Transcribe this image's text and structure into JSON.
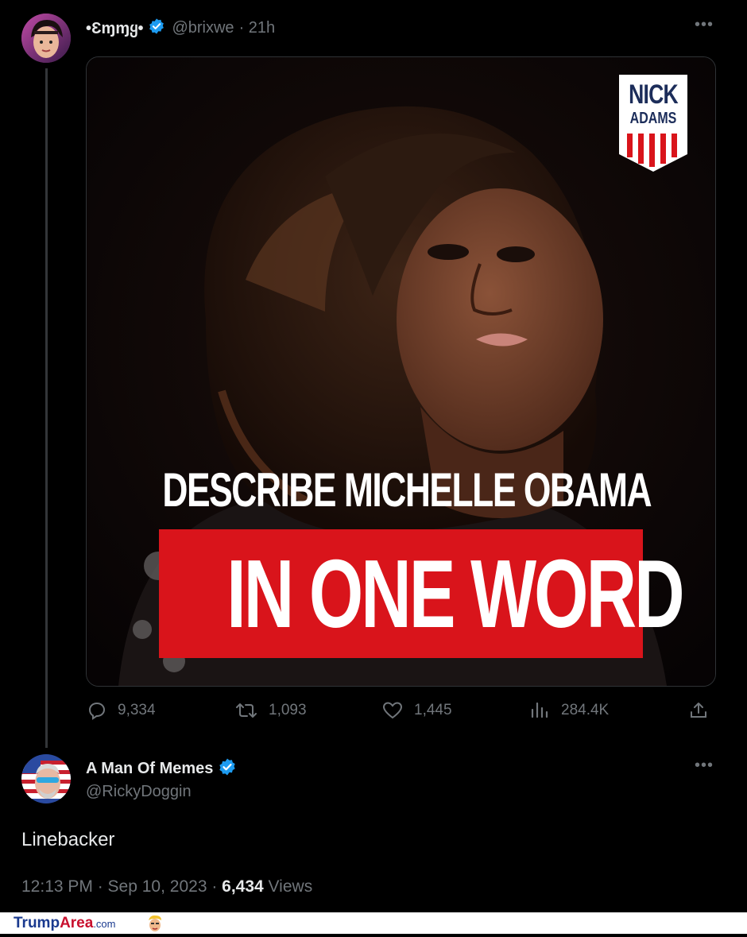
{
  "tweet": {
    "display_name": "•Ɛɱɱყ•",
    "handle": "@brixwe",
    "time": "· 21h",
    "image": {
      "headline": "DESCRIBE MICHELLE OBAMA",
      "banner": "IN ONE WORD",
      "logo_line1": "NICK",
      "logo_line2": "ADAMS"
    },
    "stats": {
      "replies": "9,334",
      "retweets": "1,093",
      "likes": "1,445",
      "views": "284.4K"
    }
  },
  "reply": {
    "display_name": "A Man Of Memes",
    "handle": "@RickyDoggin",
    "text": "Linebacker",
    "timestamp": "12:13 PM · Sep 10, 2023 · ",
    "views_count": "6,434",
    "views_label": " Views"
  },
  "watermark": {
    "part1": "Trump",
    "part2": "Area",
    "part3": ".com"
  },
  "colors": {
    "verified": "#1d9bf0",
    "muted": "#71767b",
    "banner_red": "#d9141b"
  }
}
